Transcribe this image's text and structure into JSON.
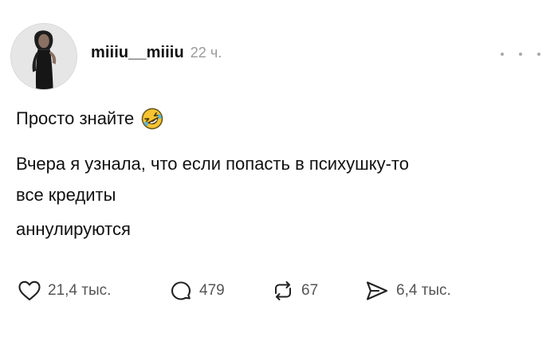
{
  "post": {
    "username": "miiiu__miiiu",
    "time": "22 ч.",
    "line1": "Просто знайте",
    "line2": "Вчера я узнала, что если попасть в психушку-то",
    "line3": "все кредиты",
    "line4": "аннулируются",
    "emoji": "rolling-on-the-floor-laughing-emoji"
  },
  "actions": {
    "likes": "21,4 тыс.",
    "comments": "479",
    "reposts": "67",
    "shares": "6,4 тыс."
  },
  "icons": {
    "like": "heart-icon",
    "comment": "comment-icon",
    "repost": "repost-icon",
    "share": "share-icon",
    "more": "more-icon"
  }
}
